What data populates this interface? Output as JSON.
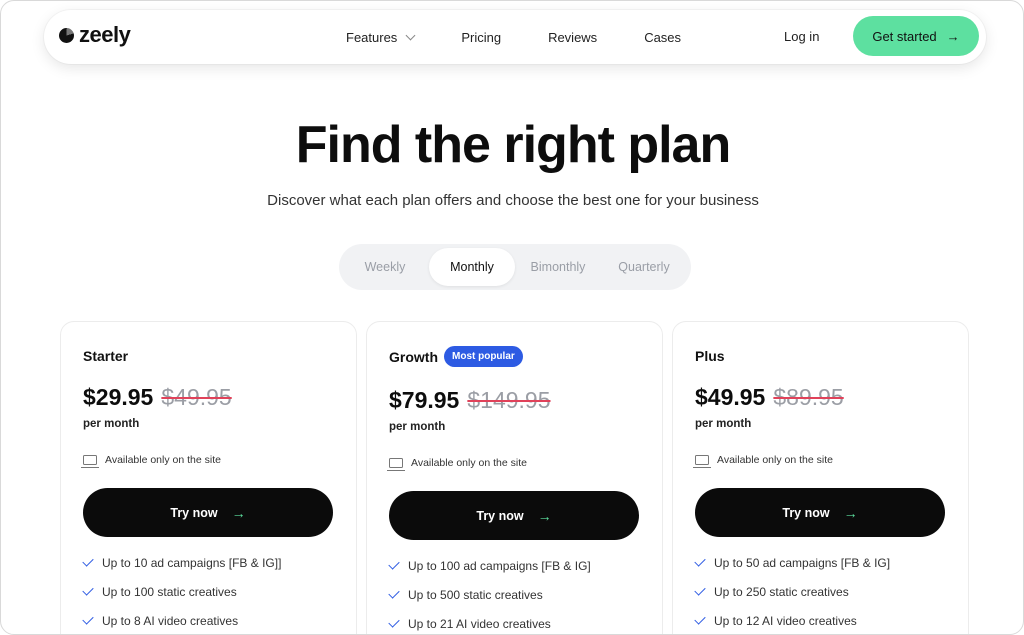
{
  "brand": {
    "name": "zeely"
  },
  "nav": {
    "links": [
      {
        "label": "Features",
        "has_dropdown": true
      },
      {
        "label": "Pricing"
      },
      {
        "label": "Reviews"
      },
      {
        "label": "Cases"
      }
    ],
    "login_label": "Log in",
    "cta_label": "Get started"
  },
  "hero": {
    "title": "Find the right plan",
    "subtitle": "Discover what each plan offers and choose the best one for your business"
  },
  "billing_toggle": {
    "options": [
      "Weekly",
      "Monthly",
      "Bimonthly",
      "Quarterly"
    ],
    "selected": "Monthly"
  },
  "plans": [
    {
      "name": "Starter",
      "badge": "",
      "price": "$29.95",
      "old_price": "$49.95",
      "period": "per month",
      "availability": "Available only on the site",
      "button_label": "Try now",
      "features": [
        "Up to 10 ad campaigns [FB & IG]]",
        "Up to 100 static creatives",
        "Up to 8 AI video creatives"
      ]
    },
    {
      "name": "Growth",
      "badge": "Most popular",
      "price": "$79.95",
      "old_price": "$149.95",
      "period": "per month",
      "availability": "Available only on the site",
      "button_label": "Try now",
      "features": [
        "Up to 100 ad campaigns [FB & IG]",
        "Up to 500 static creatives",
        "Up to 21 AI video creatives"
      ]
    },
    {
      "name": "Plus",
      "badge": "",
      "price": "$49.95",
      "old_price": "$89.95",
      "period": "per month",
      "availability": "Available only on the site",
      "button_label": "Try now",
      "features": [
        "Up to 50 ad campaigns [FB & IG]",
        "Up to 250 static creatives",
        "Up to 12 AI video creatives"
      ]
    }
  ],
  "colors": {
    "accent_green": "#5de0a0",
    "badge_blue": "#2d5be3",
    "strike_red": "#e0425a",
    "button_black": "#0b0b0b"
  }
}
